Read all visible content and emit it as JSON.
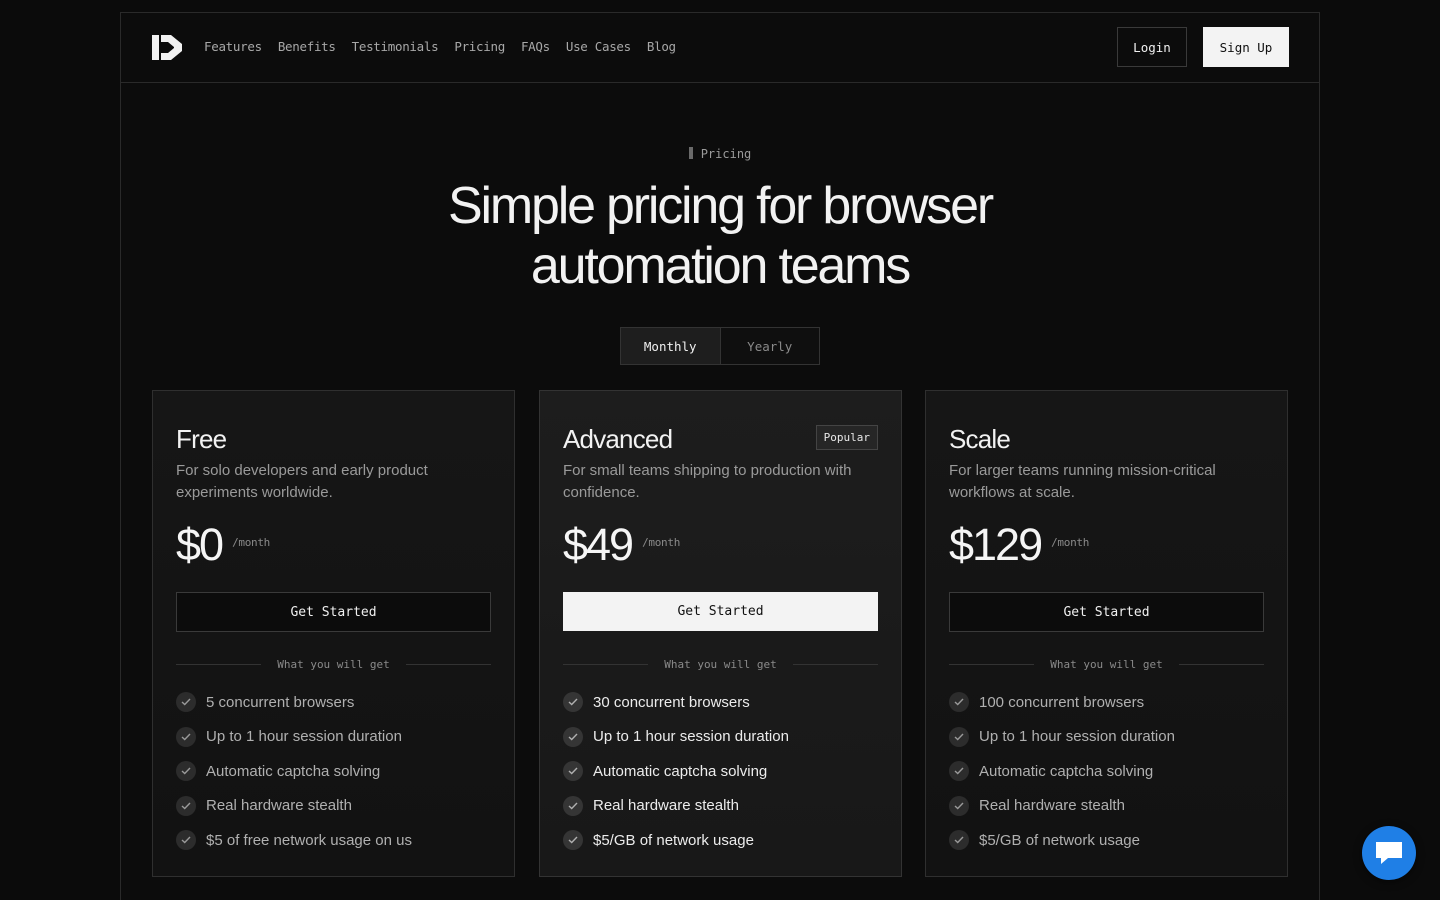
{
  "nav": {
    "items": [
      "Features",
      "Benefits",
      "Testimonials",
      "Pricing",
      "FAQs",
      "Use Cases",
      "Blog"
    ],
    "login": "Login",
    "signup": "Sign Up"
  },
  "hero": {
    "eyebrow": "Pricing",
    "title_line1": "Simple pricing for browser",
    "title_line2": "automation teams"
  },
  "billing_toggle": {
    "options": [
      "Monthly",
      "Yearly"
    ],
    "selected": "Monthly"
  },
  "plans": [
    {
      "name": "Free",
      "description": "For solo developers and early product experiments worldwide.",
      "price": "$0",
      "period": "/month",
      "cta": "Get Started",
      "divider": "What you will get",
      "features": [
        "5 concurrent browsers",
        "Up to 1 hour session duration",
        "Automatic captcha solving",
        "Real hardware stealth",
        "$5 of free network usage on us"
      ]
    },
    {
      "name": "Advanced",
      "badge": "Popular",
      "description": "For small teams shipping to production with confidence.",
      "price": "$49",
      "period": "/month",
      "cta": "Get Started",
      "divider": "What you will get",
      "features": [
        "30 concurrent browsers",
        "Up to 1 hour session duration",
        "Automatic captcha solving",
        "Real hardware stealth",
        "$5/GB of network usage"
      ]
    },
    {
      "name": "Scale",
      "description": "For larger teams running mission-critical workflows at scale.",
      "price": "$129",
      "period": "/month",
      "cta": "Get Started",
      "divider": "What you will get",
      "features": [
        "100 concurrent browsers",
        "Up to 1 hour session duration",
        "Automatic captcha solving",
        "Real hardware stealth",
        "$5/GB of network usage"
      ]
    }
  ],
  "icons": {
    "logo": "brand-logo-icon",
    "check": "check-icon",
    "chat": "chat-bubble-icon"
  },
  "colors": {
    "background": "#0b0b0b",
    "chat_button": "#1f7fe6",
    "primary_button": "#f3f3f3"
  }
}
